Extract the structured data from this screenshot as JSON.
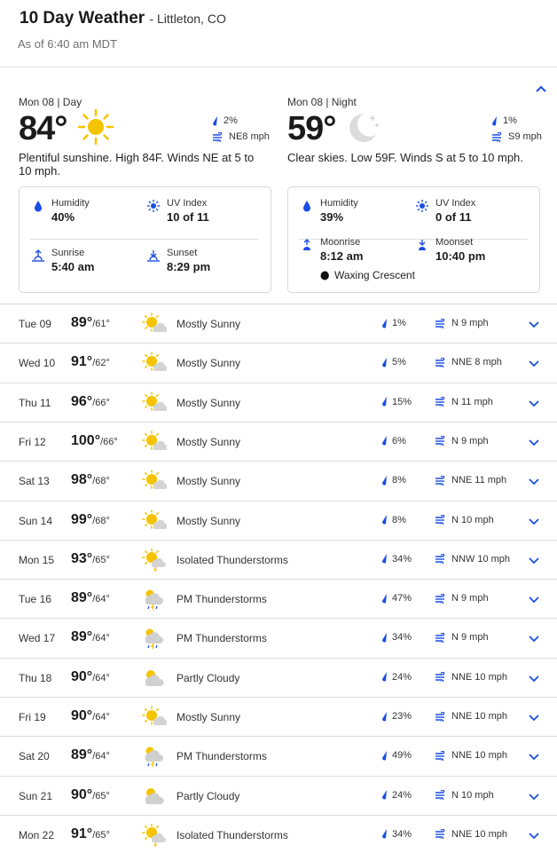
{
  "header": {
    "title": "10 Day Weather",
    "location": "Littleton, CO",
    "as_of": "As of 6:40 am MDT"
  },
  "today": {
    "day": {
      "label": "Mon 08 | Day",
      "temp": "84°",
      "icon": "sun-icon",
      "precip": "2%",
      "wind": "NE8 mph",
      "description": "Plentiful sunshine. High 84F. Winds NE at 5 to 10 mph.",
      "humidity_label": "Humidity",
      "humidity": "40%",
      "uv_label": "UV Index",
      "uv": "10 of 11",
      "sunrise_label": "Sunrise",
      "sunrise": "5:40 am",
      "sunset_label": "Sunset",
      "sunset": "8:29 pm"
    },
    "night": {
      "label": "Mon 08 | Night",
      "temp": "59°",
      "icon": "moon-stars-icon",
      "precip": "1%",
      "wind": "S9 mph",
      "description": "Clear skies. Low 59F. Winds S at 5 to 10 mph.",
      "humidity_label": "Humidity",
      "humidity": "39%",
      "uv_label": "UV Index",
      "uv": "0 of 11",
      "moonrise_label": "Moonrise",
      "moonrise": "8:12 am",
      "moonset_label": "Moonset",
      "moonset": "10:40 pm",
      "moon_phase": "Waxing Crescent"
    }
  },
  "forecast": [
    {
      "day": "Tue 09",
      "hi": "89°",
      "lo": "/61°",
      "icon": "mostly-sunny-icon",
      "phrase": "Mostly Sunny",
      "precip": "1%",
      "wind": "N 9 mph"
    },
    {
      "day": "Wed 10",
      "hi": "91°",
      "lo": "/62°",
      "icon": "mostly-sunny-icon",
      "phrase": "Mostly Sunny",
      "precip": "5%",
      "wind": "NNE 8 mph"
    },
    {
      "day": "Thu 11",
      "hi": "96°",
      "lo": "/66°",
      "icon": "mostly-sunny-icon",
      "phrase": "Mostly Sunny",
      "precip": "15%",
      "wind": "N 11 mph"
    },
    {
      "day": "Fri 12",
      "hi": "100°",
      "lo": "/66°",
      "icon": "mostly-sunny-icon",
      "phrase": "Mostly Sunny",
      "precip": "6%",
      "wind": "N 9 mph"
    },
    {
      "day": "Sat 13",
      "hi": "98°",
      "lo": "/68°",
      "icon": "mostly-sunny-icon",
      "phrase": "Mostly Sunny",
      "precip": "8%",
      "wind": "NNE 11 mph"
    },
    {
      "day": "Sun 14",
      "hi": "99°",
      "lo": "/68°",
      "icon": "mostly-sunny-icon",
      "phrase": "Mostly Sunny",
      "precip": "8%",
      "wind": "N 10 mph"
    },
    {
      "day": "Mon 15",
      "hi": "93°",
      "lo": "/65°",
      "icon": "isolated-thunderstorms-icon",
      "phrase": "Isolated Thunderstorms",
      "precip": "34%",
      "wind": "NNW 10 mph"
    },
    {
      "day": "Tue 16",
      "hi": "89°",
      "lo": "/64°",
      "icon": "pm-thunderstorms-icon",
      "phrase": "PM Thunderstorms",
      "precip": "47%",
      "wind": "N 9 mph"
    },
    {
      "day": "Wed 17",
      "hi": "89°",
      "lo": "/64°",
      "icon": "pm-thunderstorms-icon",
      "phrase": "PM Thunderstorms",
      "precip": "34%",
      "wind": "N 9 mph"
    },
    {
      "day": "Thu 18",
      "hi": "90°",
      "lo": "/64°",
      "icon": "partly-cloudy-icon",
      "phrase": "Partly Cloudy",
      "precip": "24%",
      "wind": "NNE 10 mph"
    },
    {
      "day": "Fri 19",
      "hi": "90°",
      "lo": "/64°",
      "icon": "mostly-sunny-icon",
      "phrase": "Mostly Sunny",
      "precip": "23%",
      "wind": "NNE 10 mph"
    },
    {
      "day": "Sat 20",
      "hi": "89°",
      "lo": "/64°",
      "icon": "pm-thunderstorms-icon",
      "phrase": "PM Thunderstorms",
      "precip": "49%",
      "wind": "NNE 10 mph"
    },
    {
      "day": "Sun 21",
      "hi": "90°",
      "lo": "/65°",
      "icon": "partly-cloudy-icon",
      "phrase": "Partly Cloudy",
      "precip": "24%",
      "wind": "N 10 mph"
    },
    {
      "day": "Mon 22",
      "hi": "91°",
      "lo": "/65°",
      "icon": "isolated-thunderstorms-icon",
      "phrase": "Isolated Thunderstorms",
      "precip": "34%",
      "wind": "NNE 10 mph"
    }
  ],
  "colors": {
    "accent": "#1b4de4",
    "sun": "#f5c400",
    "cloud": "#c9c9c9",
    "divider": "#dedede"
  }
}
